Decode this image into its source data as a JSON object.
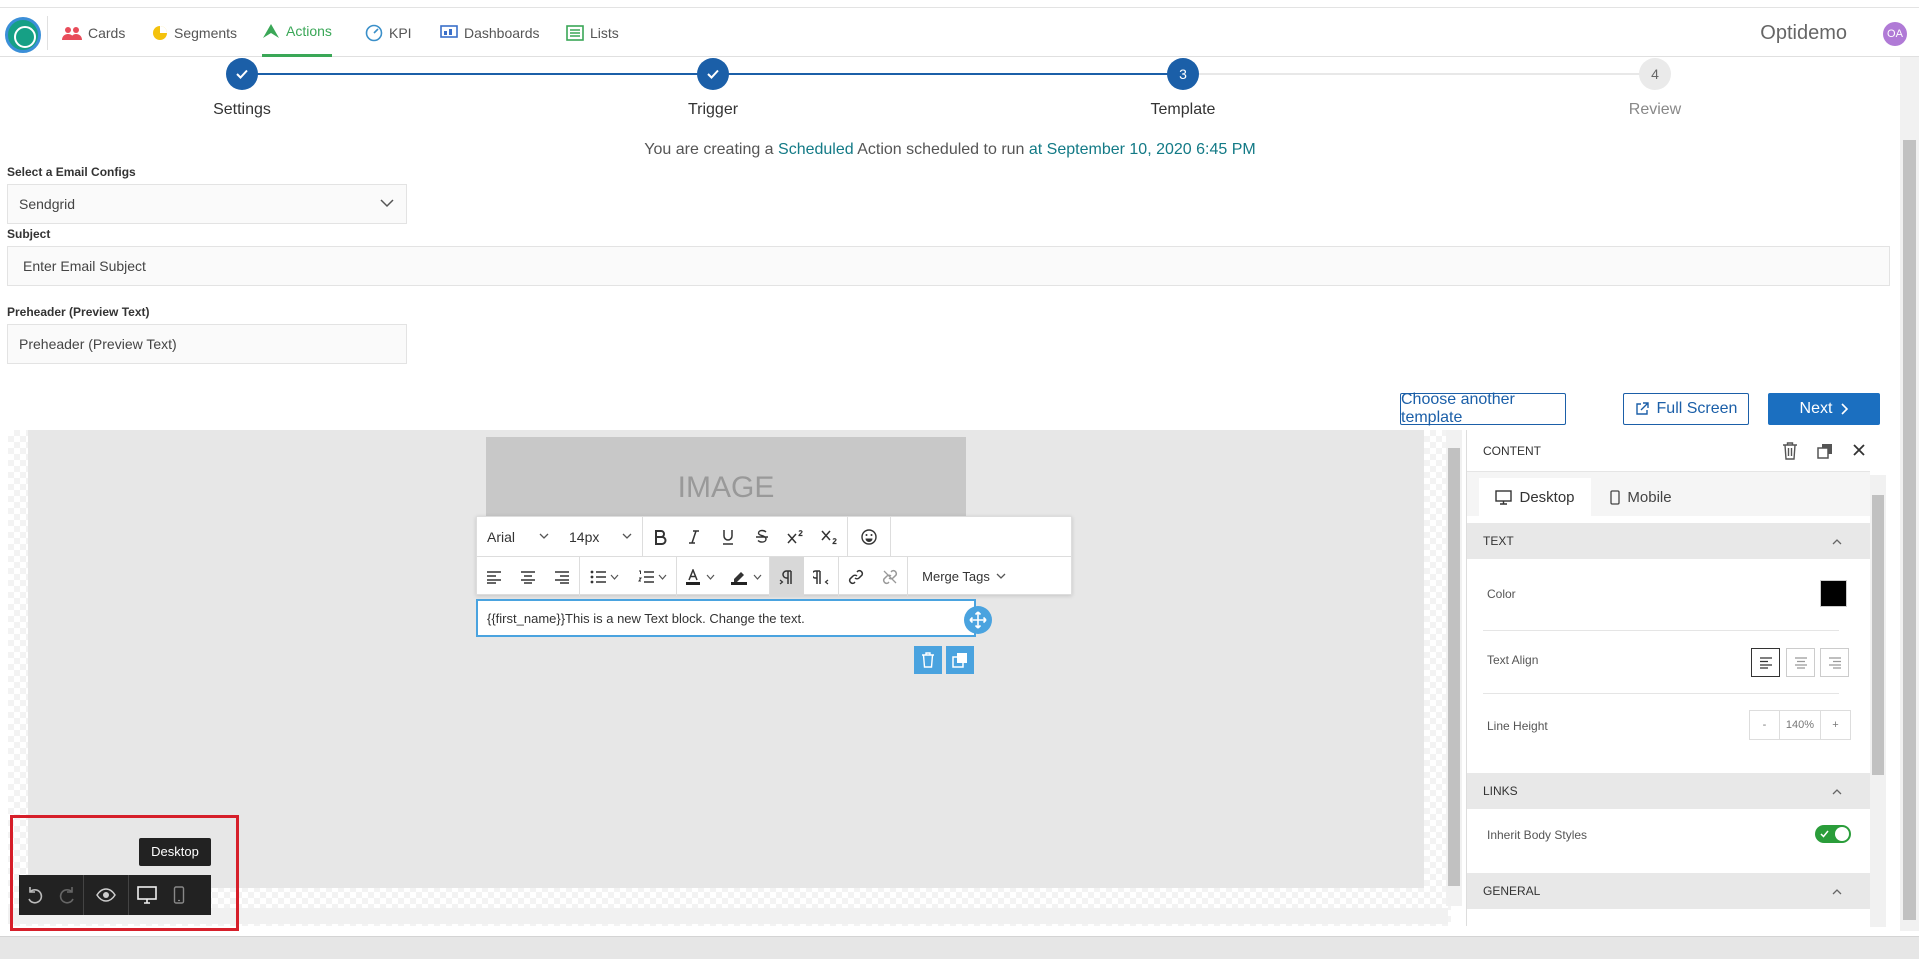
{
  "nav": {
    "items": [
      {
        "label": "Cards",
        "icon": "users-icon"
      },
      {
        "label": "Segments",
        "icon": "pie-chart-icon"
      },
      {
        "label": "Actions",
        "icon": "send-icon",
        "active": true
      },
      {
        "label": "KPI",
        "icon": "gauge-icon"
      },
      {
        "label": "Dashboards",
        "icon": "dashboard-icon"
      },
      {
        "label": "Lists",
        "icon": "list-icon"
      }
    ],
    "brand": "Optidemo",
    "avatar": "OA"
  },
  "stepper": {
    "steps": [
      {
        "label": "Settings",
        "number": "1",
        "state": "done"
      },
      {
        "label": "Trigger",
        "number": "2",
        "state": "done"
      },
      {
        "label": "Template",
        "number": "3",
        "state": "current"
      },
      {
        "label": "Review",
        "number": "4",
        "state": "pending"
      }
    ]
  },
  "schedule": {
    "prefix": "You are creating a",
    "type": "Scheduled",
    "middle": "Action scheduled to run",
    "when": "at September 10, 2020 6:45 PM"
  },
  "form": {
    "email_config_label": "Select a Email Configs",
    "email_config_value": "Sendgrid",
    "subject_label": "Subject",
    "subject_placeholder": "Enter Email Subject",
    "preheader_label": "Preheader (Preview Text)",
    "preheader_placeholder": "Preheader (Preview Text)"
  },
  "actions": {
    "choose_template": "Choose another template",
    "full_screen": "Full Screen",
    "next": "Next"
  },
  "editor": {
    "image_placeholder": "IMAGE",
    "font_family": "Arial",
    "font_size": "14px",
    "merge_tags": "Merge Tags",
    "text_block": "{{first_name}}This is a new Text block. Change the text.",
    "tooltip": "Desktop"
  },
  "panel": {
    "title": "CONTENT",
    "tabs": {
      "desktop": "Desktop",
      "mobile": "Mobile"
    },
    "text_section": "TEXT",
    "color_label": "Color",
    "color_value": "#000000",
    "text_align_label": "Text Align",
    "line_height_label": "Line Height",
    "line_height_value": "140%",
    "line_height_minus": "-",
    "line_height_plus": "+",
    "links_section": "LINKS",
    "inherit_label": "Inherit Body Styles",
    "inherit_on": true,
    "general_section": "GENERAL"
  },
  "colors": {
    "primary": "#1b5fa8",
    "active_nav": "#3aa757",
    "highlight": "#137a86",
    "editor_accent": "#4aa3df",
    "toggle_on": "#2a9d3a",
    "annotation": "#d61f2a"
  }
}
